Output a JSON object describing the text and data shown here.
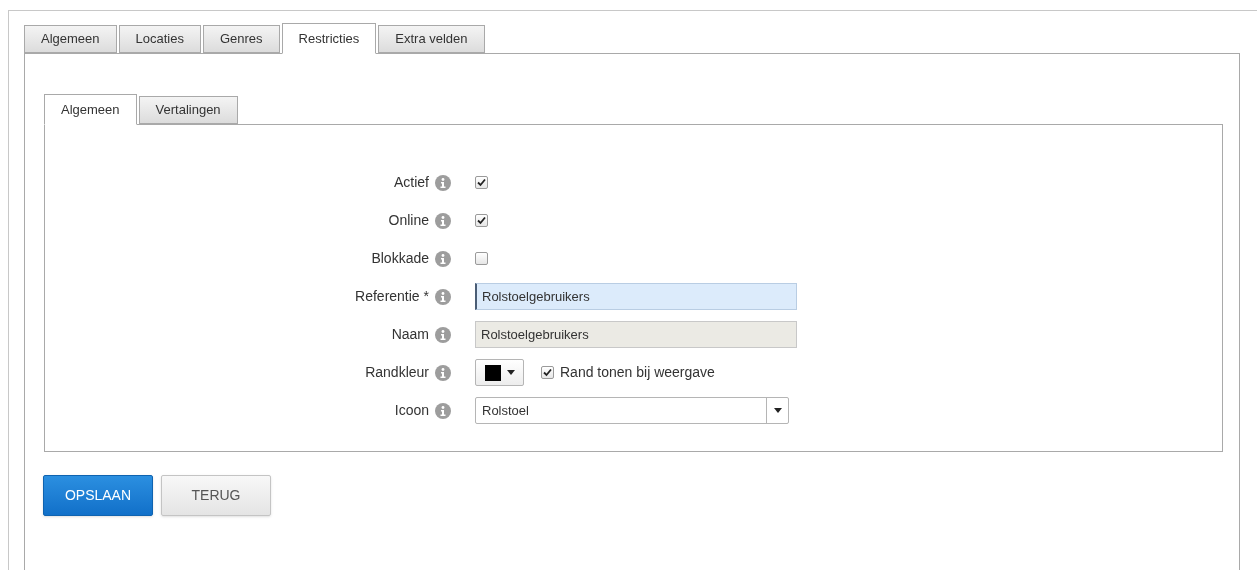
{
  "tabs": [
    {
      "label": "Algemeen",
      "selected": false
    },
    {
      "label": "Locaties",
      "selected": false
    },
    {
      "label": "Genres",
      "selected": false
    },
    {
      "label": "Restricties",
      "selected": true
    },
    {
      "label": "Extra velden",
      "selected": false
    }
  ],
  "subtabs": [
    {
      "label": "Algemeen",
      "selected": true
    },
    {
      "label": "Vertalingen",
      "selected": false
    }
  ],
  "fields": [
    {
      "kind": "checkbox",
      "label": "Actief",
      "checked": true
    },
    {
      "kind": "checkbox",
      "label": "Online",
      "checked": true
    },
    {
      "kind": "checkbox",
      "label": "Blokkade",
      "checked": false
    },
    {
      "kind": "text",
      "label": "Referentie *",
      "value": "Rolstoelgebruikers",
      "focused": true,
      "disabled": false
    },
    {
      "kind": "text",
      "label": "Naam",
      "value": "Rolstoelgebruikers",
      "focused": false,
      "disabled": true
    },
    {
      "kind": "color",
      "label": "Randkleur",
      "color": "#000000",
      "option": {
        "label": "Rand tonen bij weergave",
        "checked": true
      }
    },
    {
      "kind": "select",
      "label": "Icoon",
      "value": "Rolstoel"
    }
  ],
  "buttons": [
    {
      "label": "OPSLAAN",
      "kind": "primary"
    },
    {
      "label": "TERUG",
      "kind": "secondary"
    }
  ]
}
